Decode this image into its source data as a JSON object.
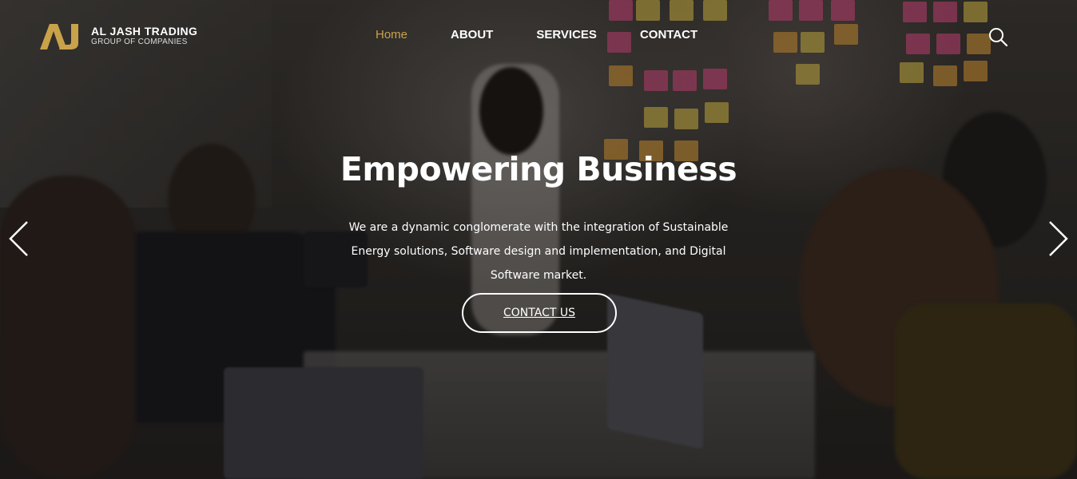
{
  "brand": {
    "title": "AL JASH TRADING",
    "subtitle": "GROUP OF COMPANIES",
    "mark_text": "AJ",
    "accent_color": "#c9a24a"
  },
  "nav": {
    "items": [
      {
        "label": "Home",
        "active": true
      },
      {
        "label": "ABOUT",
        "active": false
      },
      {
        "label": "SERVICES",
        "active": false
      },
      {
        "label": "CONTACT",
        "active": false
      }
    ],
    "search_icon": "search-icon"
  },
  "hero": {
    "title": "Empowering Business",
    "description": "We are a dynamic conglomerate with the integration of Sustainable Energy solutions, Software design and implementation, and Digital Software market.",
    "cta_label": "CONTACT US",
    "prev_icon": "chevron-left-icon",
    "next_icon": "chevron-right-icon"
  }
}
